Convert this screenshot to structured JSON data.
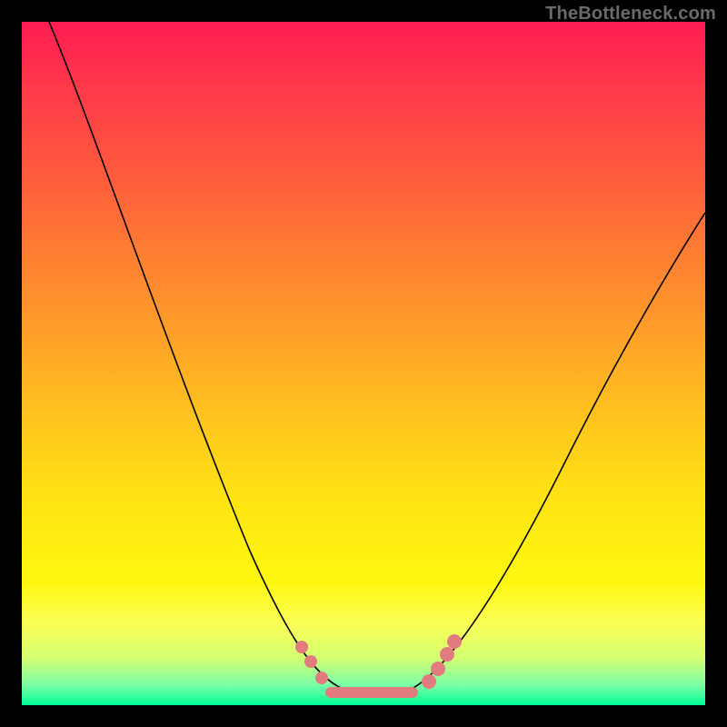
{
  "attribution": "TheBottleneck.com",
  "colors": {
    "frame": "#000000",
    "curve": "#000000",
    "marker": "#e27b80",
    "gradient_top": "#ff1c52",
    "gradient_bottom": "#00ff96"
  },
  "chart_data": {
    "type": "line",
    "title": "",
    "xlabel": "",
    "ylabel": "",
    "xlim": [
      0,
      100
    ],
    "ylim": [
      0,
      100
    ],
    "annotations": [
      "TheBottleneck.com"
    ],
    "series": [
      {
        "name": "bottleneck-curve",
        "x": [
          5,
          10,
          15,
          20,
          25,
          30,
          35,
          40,
          43,
          46,
          49,
          52,
          55,
          58,
          62,
          68,
          75,
          82,
          90,
          98
        ],
        "y": [
          100,
          88,
          76,
          64,
          52,
          40,
          28,
          16,
          8,
          3,
          1,
          0,
          0,
          1,
          5,
          14,
          26,
          38,
          50,
          60
        ]
      }
    ],
    "flat_region": {
      "x_start": 46,
      "x_end": 58,
      "y": 1
    },
    "markers": [
      {
        "x": 41,
        "y": 10
      },
      {
        "x": 43,
        "y": 7
      },
      {
        "x": 45,
        "y": 4
      },
      {
        "x": 60,
        "y": 3
      },
      {
        "x": 62,
        "y": 6
      },
      {
        "x": 64,
        "y": 10
      }
    ]
  }
}
